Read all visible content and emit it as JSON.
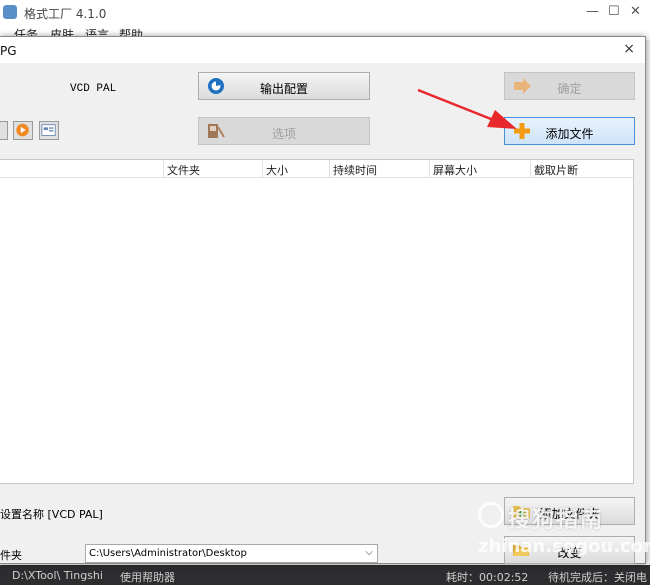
{
  "main_window": {
    "title": "格式工厂 4.1.0",
    "controls": {
      "minimize": "—",
      "maximize": "☐",
      "close": "✕"
    },
    "menu": [
      "任务",
      "皮肤",
      "语言",
      "帮助"
    ]
  },
  "dialog": {
    "title": "PG",
    "close": "×",
    "profile": "VCD PAL",
    "output_config_label": "输出配置",
    "ok_label": "确定",
    "options_label": "选项",
    "add_file_label": "添加文件",
    "columns": [
      "文件夹",
      "大小",
      "持续时间",
      "屏幕大小",
      "截取片断"
    ],
    "output_setting": "设置名称 [VCD PAL]",
    "add_folder_label": "添加文件夹",
    "folder_label": "件夹",
    "folder_path": "C:\\Users\\Administrator\\Desktop",
    "change_label": "改变"
  },
  "taskbar": {
    "items": [
      "D:\\XTool\\ Tingshi",
      "使用帮助器",
      "耗时：00:02:52",
      "待机完成后：关闭电脑"
    ]
  },
  "watermark": {
    "text": "搜狗指南",
    "sub": "zhinan.sogou.com"
  },
  "colors": {
    "accent_border": "#4a90d9",
    "annotation_arrow": "#e8282b",
    "plus_icon": "#f39c12"
  }
}
